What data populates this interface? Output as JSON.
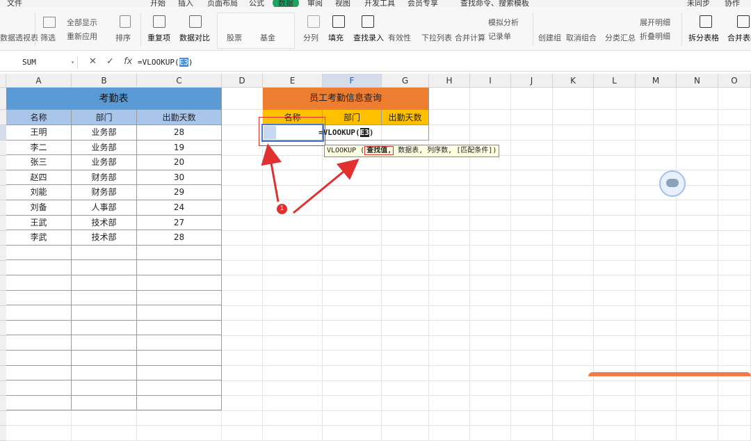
{
  "menu": {
    "file": "文件",
    "tabs": [
      "开始",
      "插入",
      "页面布局",
      "公式",
      "数据",
      "审阅",
      "视图",
      "开发工具",
      "会员专享"
    ],
    "search": "查找命令、搜索模板",
    "right": [
      "未同步",
      "协作"
    ]
  },
  "ribbon": {
    "pivot": "数据透视表",
    "filter": "筛选",
    "show_all": "全部显示",
    "reapply": "重新应用",
    "sort": "排序",
    "dup": "重复项",
    "compare": "数据对比",
    "stock": "股票",
    "fund": "基金",
    "split_col": "分列",
    "fill": "填充",
    "lookup_entry": "查找录入",
    "validity": "有效性",
    "dropdown": "下拉列表",
    "consolidate": "合并计算",
    "simulate": "模拟分析",
    "record": "记录单",
    "create_group": "创建组",
    "ungroup": "取消组合",
    "subtotal": "分类汇总",
    "expand": "展开明细",
    "collapse": "折叠明细",
    "split_table": "拆分表格",
    "merge_table": "合并表格"
  },
  "formula_bar": {
    "name_box": "SUM",
    "cancel": "✕",
    "confirm": "✓",
    "fx": "fx",
    "formula_prefix": "=VLOOKUP(",
    "formula_ref": "E3",
    "formula_suffix": ")"
  },
  "columns": [
    "A",
    "B",
    "C",
    "D",
    "E",
    "F",
    "G",
    "H",
    "I",
    "J",
    "K",
    "L",
    "M",
    "N",
    "O"
  ],
  "attendance_table": {
    "title": "考勤表",
    "headers": [
      "名称",
      "部门",
      "出勤天数"
    ],
    "rows": [
      [
        "王明",
        "业务部",
        "28"
      ],
      [
        "李二",
        "业务部",
        "19"
      ],
      [
        "张三",
        "业务部",
        "20"
      ],
      [
        "赵四",
        "财务部",
        "30"
      ],
      [
        "刘能",
        "财务部",
        "29"
      ],
      [
        "刘备",
        "人事部",
        "24"
      ],
      [
        "王武",
        "技术部",
        "27"
      ],
      [
        "李武",
        "技术部",
        "28"
      ]
    ]
  },
  "query_table": {
    "title": "员工考勤信息查询",
    "headers": [
      "名称",
      "部门",
      "出勤天数"
    ],
    "formula_prefix": "=VLOOKUP(",
    "formula_ref": "E3",
    "formula_suffix": ")"
  },
  "tooltip": {
    "func": "VLOOKUP",
    "arg1": "查找值,",
    "rest": " 数据表, 列序数, [匹配条件])"
  },
  "annotation": {
    "badge": "1",
    "color": "#e03030"
  },
  "colors": {
    "accent": "#1fa463",
    "blue_title": "#5b9bd5",
    "blue_header": "#a9c6ea",
    "orange_title": "#ed7d31",
    "yellow_header": "#ffc000"
  }
}
